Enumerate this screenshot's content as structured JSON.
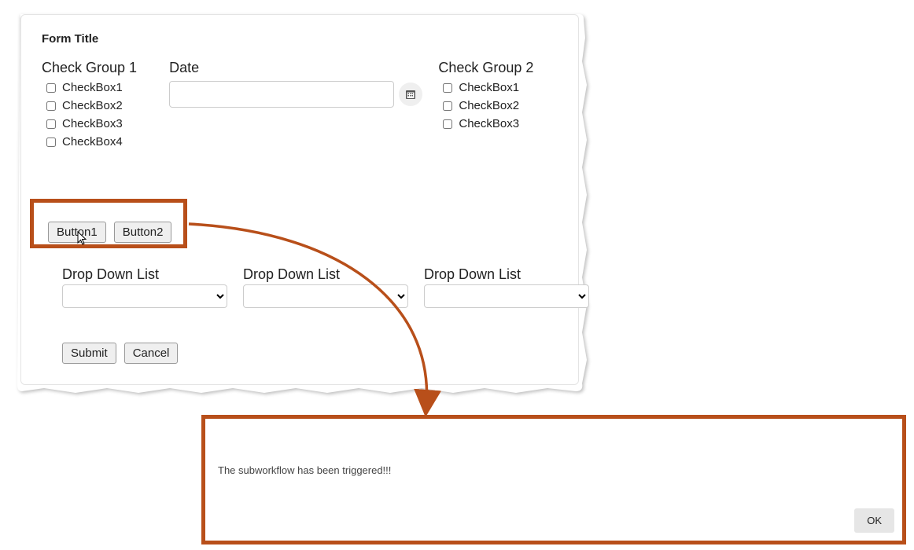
{
  "accent_color": "#b84f1a",
  "form": {
    "title": "Form Title",
    "check_group_1": {
      "label": "Check Group 1",
      "items": [
        "CheckBox1",
        "CheckBox2",
        "CheckBox3",
        "CheckBox4"
      ]
    },
    "date": {
      "label": "Date",
      "value": ""
    },
    "check_group_2": {
      "label": "Check Group 2",
      "items": [
        "CheckBox1",
        "CheckBox2",
        "CheckBox3"
      ]
    },
    "button1_label": "Button1",
    "button2_label": "Button2",
    "dropdowns": [
      {
        "label": "Drop Down List",
        "value": ""
      },
      {
        "label": "Drop Down List",
        "value": ""
      },
      {
        "label": "Drop Down List",
        "value": ""
      }
    ],
    "submit_label": "Submit",
    "cancel_label": "Cancel"
  },
  "dialog": {
    "message": "The subworkflow has been triggered!!!",
    "ok_label": "OK"
  }
}
